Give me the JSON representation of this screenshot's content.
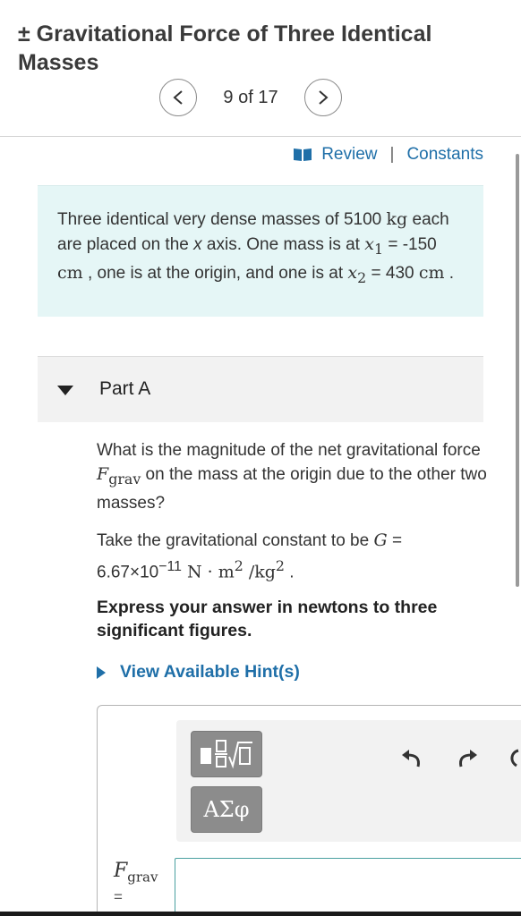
{
  "header": {
    "title": "± Gravitational Force of Three Identical Masses",
    "pager": "9 of 17"
  },
  "links": {
    "review": "Review",
    "separator": "|",
    "constants": "Constants"
  },
  "problem": {
    "text_before_m": "Three identical very dense masses of 5100 ",
    "unit_kg": "kg",
    "text_axis_1": " each are placed on the ",
    "x_axis_var": "x",
    "text_axis_2": " axis. One mass is at ",
    "x1_var": "x",
    "x1_sub": "1",
    "x1_value": " = -150 ",
    "unit_cm1": "cm",
    "text_middle": " , one is at the origin, and one is at ",
    "x2_var": "x",
    "x2_sub": "2",
    "x2_value": " = 430 ",
    "unit_cm2": "cm",
    "end": " ."
  },
  "part": {
    "label": "Part A"
  },
  "question": {
    "text1": "What is the magnitude of the net gravitational force ",
    "f_var": "F",
    "f_sub": "grav",
    "text2": " on the mass at the origin due to the other two masses?"
  },
  "constant": {
    "text1": "Take the gravitational constant to be ",
    "g_var": "G",
    "text2": " = 6.67×10",
    "exp": "−11",
    "unit": " N · m",
    "unit_exp": "2",
    "unit2": " /kg",
    "unit2_exp": "2",
    "end": " ."
  },
  "express": "Express your answer in newtons to three significant figures.",
  "hint": "View Available Hint(s)",
  "toolbar": {
    "templates_icon": "radical-template-icon",
    "symbols_label": "ΑΣφ",
    "undo_icon": "undo-icon",
    "redo_icon": "redo-icon",
    "reset_icon": "reset-icon"
  },
  "answer": {
    "var": "F",
    "sub": "grav",
    "eq": "=",
    "value": ""
  },
  "colors": {
    "link": "#1f6fa8",
    "problem_bg": "#e5f6f6",
    "part_bg": "#f2f2f2",
    "tool_btn": "#8c8c8c"
  }
}
